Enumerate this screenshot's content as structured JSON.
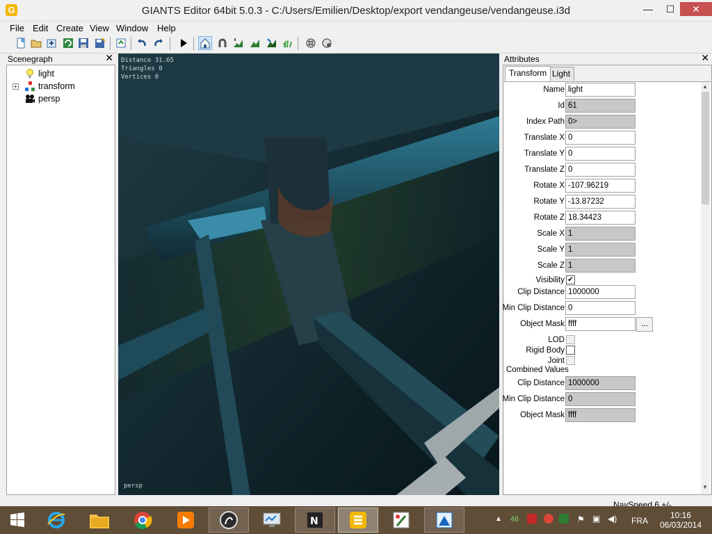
{
  "window": {
    "title": "GIANTS Editor 64bit 5.0.3 - C:/Users/Emilien/Desktop/export vendangeuse/vendangeuse.i3d",
    "app_icon_letter": "G",
    "minimize": "—",
    "maximize": "☐",
    "close": "✕"
  },
  "menu": [
    "File",
    "Edit",
    "Create",
    "View",
    "Window",
    "Help"
  ],
  "toolbar": {
    "buttons": [
      "new-icon",
      "open-icon",
      "import-icon",
      "refresh-icon",
      "save-icon",
      "save-as-icon",
      "export-icon",
      "undo-icon",
      "redo-icon",
      "play-icon",
      "home-icon",
      "magnet-icon",
      "terrain-raise-icon",
      "terrain-paint-icon",
      "terrain-smooth-icon",
      "foliage-paint-icon",
      "particle-icon",
      "particle-settings-icon"
    ]
  },
  "scenegraph": {
    "title": "Scenegraph",
    "close": "✕",
    "items": [
      {
        "label": "light",
        "icon": "light-bulb-icon",
        "expandable": false
      },
      {
        "label": "transform",
        "icon": "transform-node-icon",
        "expandable": true
      },
      {
        "label": "persp",
        "icon": "camera-icon",
        "expandable": false
      }
    ]
  },
  "viewport": {
    "stats": [
      "Distance 31.65",
      "Triangles 0",
      "Vertices 0"
    ],
    "camera": "persp"
  },
  "attributes": {
    "title": "Attributes",
    "close": "✕",
    "tabs": [
      "Transform",
      "Light"
    ],
    "active_tab": "Transform",
    "fields": [
      {
        "label": "Name",
        "value": "light",
        "readonly": false
      },
      {
        "label": "Id",
        "value": "61",
        "readonly": true
      },
      {
        "label": "Index Path",
        "value": "0>",
        "readonly": true
      },
      {
        "label": "Translate X",
        "value": "0",
        "readonly": false
      },
      {
        "label": "Translate Y",
        "value": "0",
        "readonly": false
      },
      {
        "label": "Translate Z",
        "value": "0",
        "readonly": false
      },
      {
        "label": "Rotate X",
        "value": "-107.96219",
        "readonly": false
      },
      {
        "label": "Rotate Y",
        "value": "-13.87232",
        "readonly": false
      },
      {
        "label": "Rotate Z",
        "value": "18.34423",
        "readonly": false
      },
      {
        "label": "Scale X",
        "value": "1",
        "readonly": true
      },
      {
        "label": "Scale Y",
        "value": "1",
        "readonly": true
      },
      {
        "label": "Scale Z",
        "value": "1",
        "readonly": true
      }
    ],
    "visibility_label": "Visibility",
    "visibility_checked": "✔",
    "clip_distance": {
      "label": "Clip Distance",
      "value": "1000000"
    },
    "min_clip_distance": {
      "label": "Min Clip Distance",
      "value": "0"
    },
    "object_mask": {
      "label": "Object Mask",
      "value": "ffff",
      "button": "..."
    },
    "lod_label": "LOD",
    "rigid_body_label": "Rigid Body",
    "joint_label": "Joint",
    "combined_values_label": "Combined Values",
    "combined": [
      {
        "label": "Clip Distance",
        "value": "1000000"
      },
      {
        "label": "Min Clip Distance",
        "value": "0"
      },
      {
        "label": "Object Mask",
        "value": "ffff"
      }
    ]
  },
  "status": {
    "navspeed": "NavSpeed 6 +/-"
  },
  "taskbar": {
    "apps": [
      "ie-icon",
      "file-explorer-icon",
      "chrome-icon",
      "media-player-icon",
      "photoshop-icon",
      "monitor-icon",
      "notepad-plus-icon",
      "giants-editor-icon",
      "paint-icon",
      "image-editor-icon"
    ],
    "tray_badge": "46",
    "language": "FRA",
    "time": "10:16",
    "date": "06/03/2014"
  }
}
